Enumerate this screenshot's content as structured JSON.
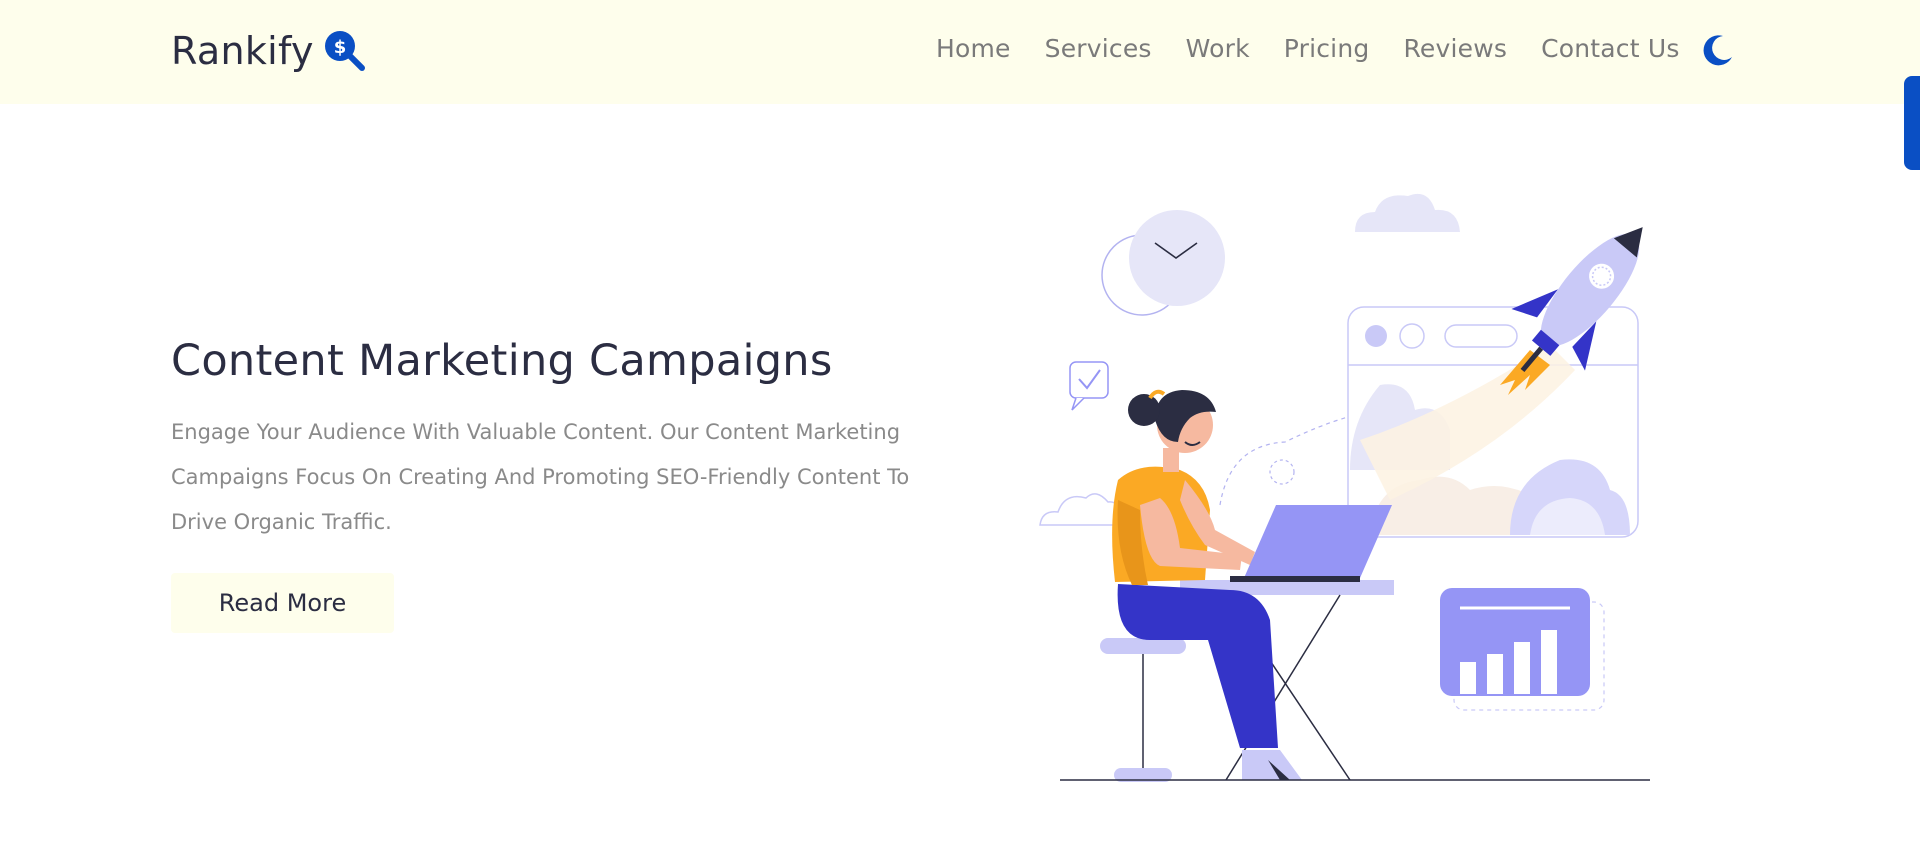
{
  "brand": {
    "name": "Rankify",
    "logo_icon": "dollar-search-icon",
    "accent": "#0a4fc4"
  },
  "nav": {
    "links": [
      {
        "label": "Home"
      },
      {
        "label": "Services"
      },
      {
        "label": "Work"
      },
      {
        "label": "Pricing"
      },
      {
        "label": "Reviews"
      },
      {
        "label": "Contact Us"
      }
    ],
    "theme_toggle_icon": "moon-icon"
  },
  "hero": {
    "title": "Content Marketing Campaigns",
    "description": "Engage Your Audience With Valuable Content. Our Content Marketing Campaigns Focus On Creating And Promoting SEO-Friendly Content To Drive Organic Traffic.",
    "cta_label": "Read More"
  },
  "colors": {
    "navbar_bg": "#fefeec",
    "heading": "#2b2d42",
    "body_text": "#8a8a8a",
    "illustration_purple": "#9595f5",
    "illustration_lavender": "#c9c9f7",
    "illustration_orange": "#fba924"
  }
}
